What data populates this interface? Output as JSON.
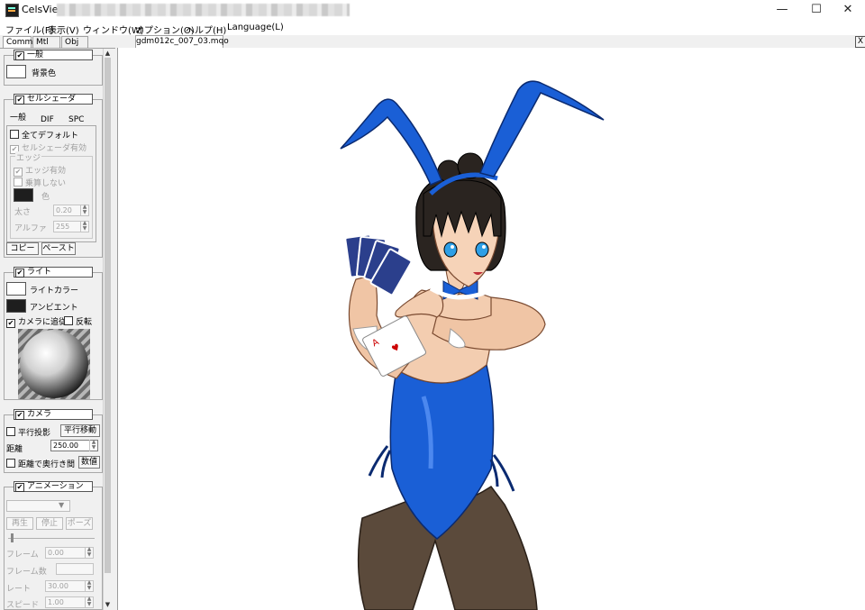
{
  "window": {
    "title": "CelsView",
    "minimize": "—",
    "maximize": "☐",
    "close": "✕"
  },
  "menu": [
    "ファイル(F)",
    "表示(V)",
    "ウィンドウ(W)",
    "オプション(O)",
    "ヘルプ(H)",
    "Language(L)"
  ],
  "document_tab": {
    "label": "gdm012c_007_03.mqo",
    "close": "X"
  },
  "panel_tabs": [
    "Comm",
    "Mtl",
    "Obj"
  ],
  "general": {
    "title": "一般",
    "bgcolor_label": "背景色"
  },
  "cel_shader": {
    "title": "セルシェーダ",
    "tabs": [
      "一般",
      "DIF",
      "SPC"
    ],
    "all_default": "全てデフォルト",
    "shader_enabled": "セルシェーダ有効",
    "edge_group": "エッジ",
    "edge_enabled": "エッジ有効",
    "no_multiply": "乗算しない",
    "color_label": "色",
    "thickness_label": "太さ",
    "thickness_value": "0.20",
    "alpha_label": "アルファ",
    "alpha_value": "255",
    "copy_button": "コピー",
    "paste_button": "ペースト"
  },
  "light": {
    "title": "ライト",
    "light_color_label": "ライトカラー",
    "ambient_label": "アンビエント",
    "follow_camera": "カメラに追従",
    "invert": "反転"
  },
  "camera": {
    "title": "カメラ",
    "parallel_projection": "平行投影",
    "translate_button": "平行移動",
    "distance_label": "距離",
    "distance_value": "250.00",
    "distance_depth": "距離で奥行き間",
    "numeric_button": "数値"
  },
  "animation": {
    "title": "アニメーション",
    "play_button": "再生",
    "stop_button": "停止",
    "pose_button": "ポーズ",
    "frame_label": "フレーム",
    "frame_value": "0.00",
    "frame_count_label": "フレーム数",
    "frame_count_value": "",
    "rate_label": "レート",
    "rate_value": "30.00",
    "speed_label": "スピード",
    "speed_value": "1.00"
  },
  "colors": {
    "accent_blue": "#1a5fd6",
    "hair": "#2a2420",
    "stocking": "#5a4a3c",
    "background_swatch_light": "#ffffff",
    "background_swatch_ambient": "#1e1e1e"
  },
  "cards": {
    "corner_rank": "A"
  }
}
